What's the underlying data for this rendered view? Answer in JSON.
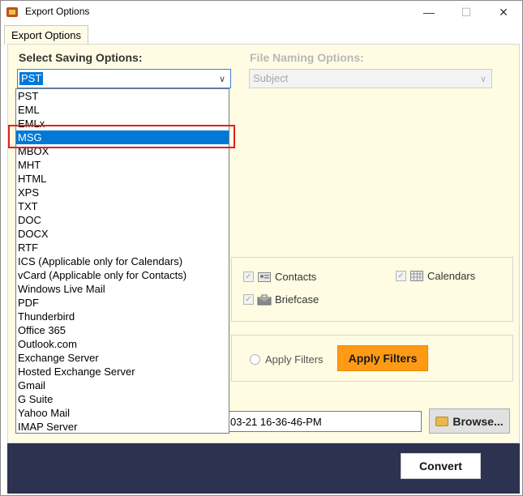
{
  "window": {
    "title": "Export Options",
    "minimize": "—",
    "maximize": "☐",
    "close": "✕"
  },
  "tabs": [
    {
      "label": "Export Options"
    }
  ],
  "saving": {
    "label": "Select Saving Options:",
    "value": "PST",
    "options": [
      "PST",
      "EML",
      "EMLx",
      "MSG",
      "MBOX",
      "MHT",
      "HTML",
      "XPS",
      "TXT",
      "DOC",
      "DOCX",
      "RTF",
      "ICS (Applicable only for Calendars)",
      "vCard (Applicable only for Contacts)",
      "Windows Live Mail",
      "PDF",
      "Thunderbird",
      "Office 365",
      "Outlook.com",
      "Exchange Server",
      "Hosted Exchange Server",
      "Gmail",
      "G Suite",
      "Yahoo Mail",
      "IMAP Server"
    ],
    "hovered": "MSG"
  },
  "naming": {
    "label": "File Naming Options:",
    "value": "Subject"
  },
  "categories": {
    "contacts": "Contacts",
    "calendars": "Calendars",
    "briefcase": "Briefcase"
  },
  "filters": {
    "radio_label": "Apply Filters",
    "button_label": "Apply Filters"
  },
  "destination": {
    "path_visible": "03-21 16-36-46-PM",
    "browse_label": "Browse..."
  },
  "footer": {
    "convert_label": "Convert"
  },
  "colors": {
    "accent": "#0078d7",
    "apply_button": "#ff9a14",
    "panel": "#fffce3",
    "footer": "#2d3250",
    "highlight": "#e02020"
  }
}
